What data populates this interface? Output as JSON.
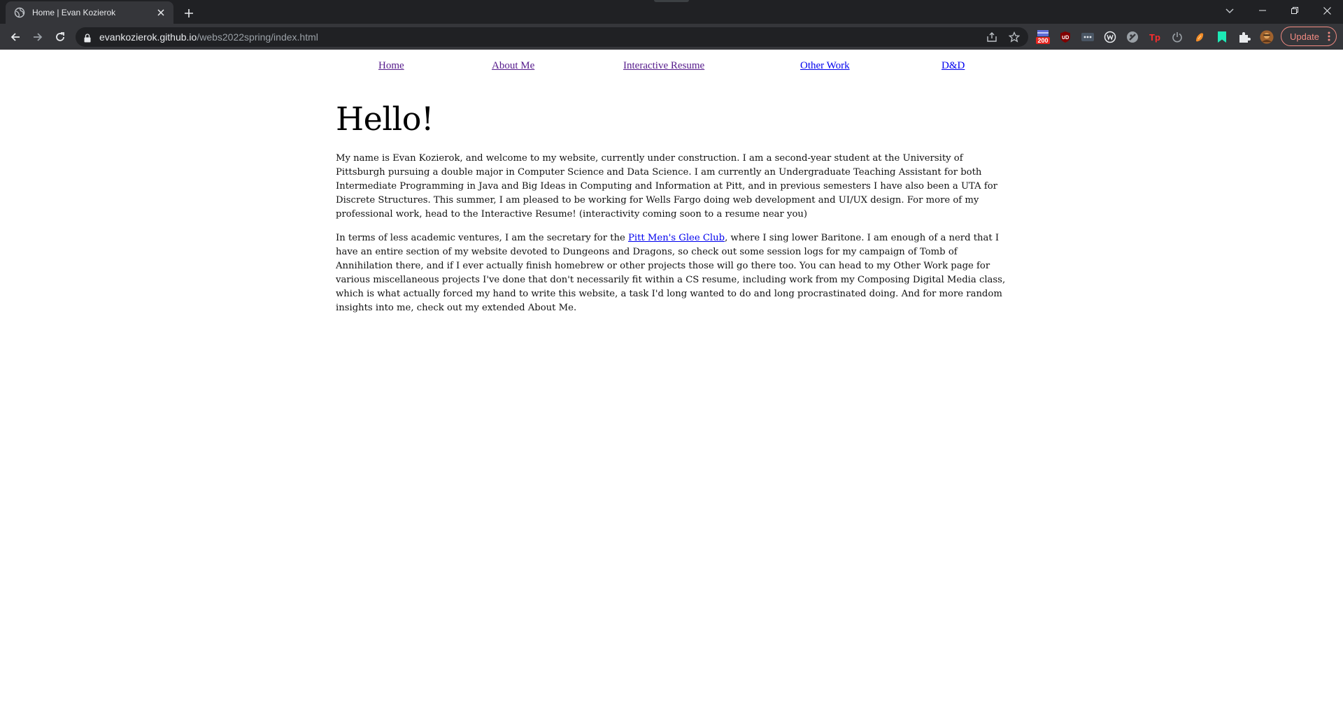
{
  "browser": {
    "tab_title": "Home | Evan Kozierok",
    "url_host": "evankozierok.github.io",
    "url_path": "/webs2022spring/index.html",
    "update_label": "Update",
    "extension_badge": "200"
  },
  "nav": {
    "home": "Home",
    "about": "About Me",
    "resume": "Interactive Resume",
    "other": "Other Work",
    "dnd": "D&D"
  },
  "main": {
    "heading": "Hello!",
    "para1": "My name is Evan Kozierok, and welcome to my website, currently under construction. I am a second-year student at the University of Pittsburgh pursuing a double major in Computer Science and Data Science. I am currently an Undergraduate Teaching Assistant for both Intermediate Programming in Java and Big Ideas in Computing and Information at Pitt, and in previous semesters I have also been a UTA for Discrete Structures. This summer, I am pleased to be working for Wells Fargo doing web development and UI/UX design. For more of my professional work, head to the Interactive Resume! (interactivity coming soon to a resume near you)",
    "para2_before": "In terms of less academic ventures, I am the secretary for the ",
    "para2_link": "Pitt Men's Glee Club",
    "para2_after": ", where I sing lower Baritone. I am enough of a nerd that I have an entire section of my website devoted to Dungeons and Dragons, so check out some session logs for my campaign of Tomb of Annihilation there, and if I ever actually finish homebrew or other projects those will go there too. You can head to my Other Work page for various miscellaneous projects I've done that don't necessarily fit within a CS resume, including work from my Composing Digital Media class, which is what actually forced my hand to write this website, a task I'd long wanted to do and long procrastinated doing. And for more random insights into me, check out my extended About Me."
  },
  "colors": {
    "visited_link": "#551a8b",
    "link": "#0000ee",
    "chrome_dark": "#202124",
    "chrome_toolbar": "#35363a",
    "update_accent": "#f28b82"
  }
}
